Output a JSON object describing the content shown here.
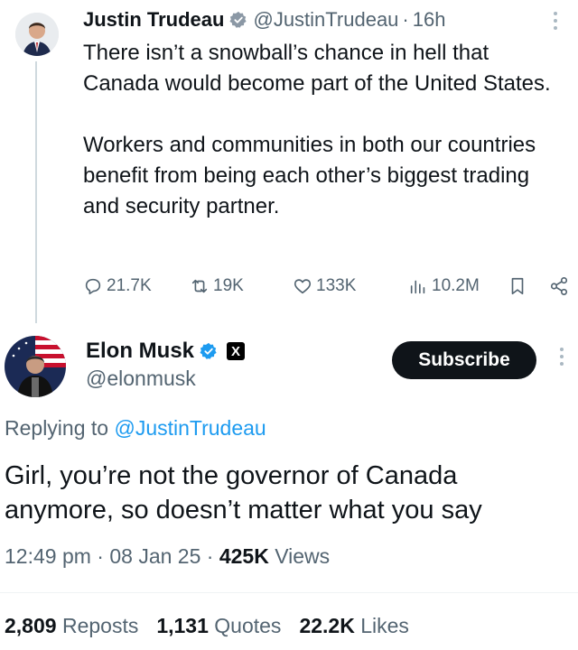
{
  "original_tweet": {
    "author_name": "Justin Trudeau",
    "handle": "@JustinTrudeau",
    "separator": "·",
    "time": "16h",
    "text": "There isn’t a snowball’s chance in hell that Canada would become part of the United States.\n\nWorkers and communities in both our countries benefit from being each other’s biggest trading and security partner.",
    "stats": {
      "replies": "21.7K",
      "reposts": "19K",
      "likes": "133K",
      "views": "10.2M"
    }
  },
  "reply": {
    "author_name": "Elon Musk",
    "handle": "@elonmusk",
    "badge": "X",
    "subscribe_label": "Subscribe",
    "replying_prefix": "Replying to",
    "replying_handle": "@JustinTrudeau",
    "text": "Girl, you’re not the governor of Canada anymore, so doesn’t matter what you say",
    "time": "12:49 pm",
    "date": "08 Jan 25",
    "views_count": "425K",
    "views_label": "Views",
    "meta_sep": "·",
    "engagement": {
      "reposts_count": "2,809",
      "reposts_label": "Reposts",
      "quotes_count": "1,131",
      "quotes_label": "Quotes",
      "likes_count": "22.2K",
      "likes_label": "Likes"
    }
  },
  "colors": {
    "link": "#1d9bf0",
    "muted": "#536471",
    "text": "#0f1419"
  }
}
